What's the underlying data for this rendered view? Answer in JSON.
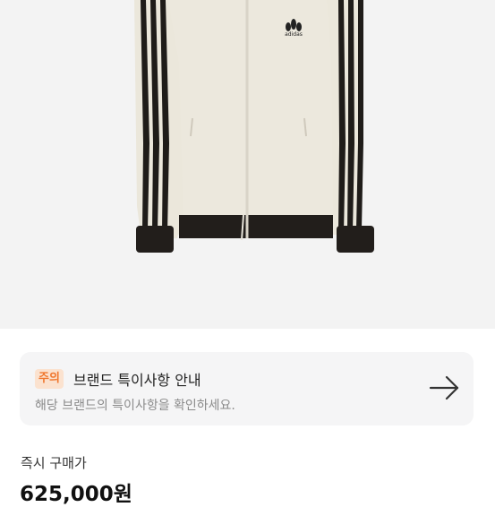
{
  "product": {
    "image_icon": "product-photo",
    "logo_text": "adidas"
  },
  "notice": {
    "badge": "주의",
    "title": "브랜드 특이사항 안내",
    "description": "해당 브랜드의 특이사항을 확인하세요.",
    "icon": "arrow-right-icon",
    "badge_bg": "#fbe2cf",
    "badge_color": "#f0772e"
  },
  "purchase": {
    "label": "즉시 구매가",
    "price": "625,000원"
  }
}
